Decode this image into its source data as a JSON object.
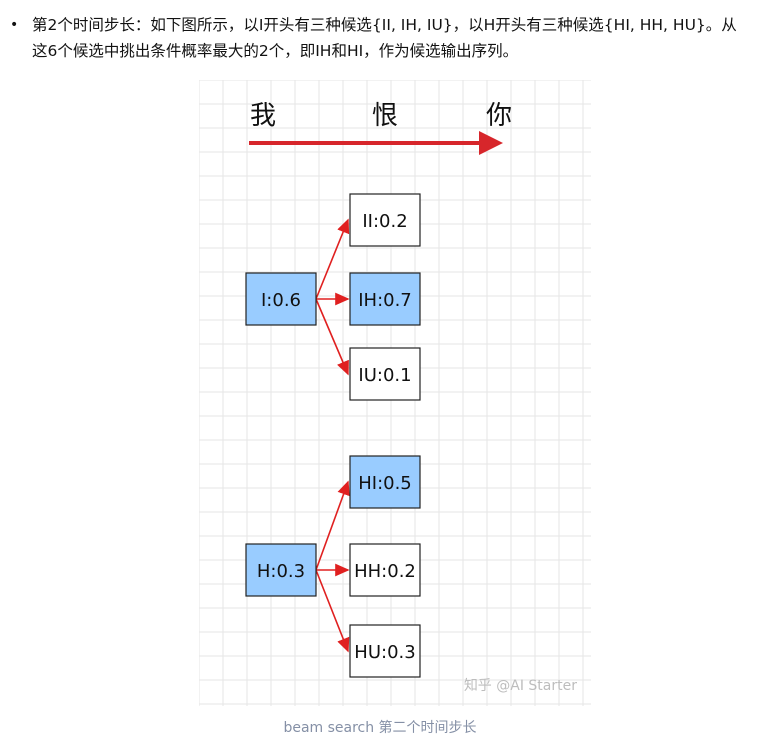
{
  "paragraph": {
    "bullet": "•",
    "text": "第2个时间步长：如下图所示，以I开头有三种候选{II, IH, IU}，以H开头有三种候选{HI, HH, HU}。从这6个候选中挑出条件概率最大的2个，即IH和HI，作为候选输出序列。"
  },
  "diagram": {
    "timeline": {
      "words": [
        "我",
        "恨",
        "你"
      ],
      "arrow_color": "#d7262b"
    },
    "groups": [
      {
        "parent": {
          "label": "I:0.6",
          "selected": true
        },
        "children": [
          {
            "label": "II:0.2",
            "selected": false
          },
          {
            "label": "IH:0.7",
            "selected": true
          },
          {
            "label": "IU:0.1",
            "selected": false
          }
        ]
      },
      {
        "parent": {
          "label": "H:0.3",
          "selected": true
        },
        "children": [
          {
            "label": "HI:0.5",
            "selected": true
          },
          {
            "label": "HH:0.2",
            "selected": false
          },
          {
            "label": "HU:0.3",
            "selected": false
          }
        ]
      }
    ],
    "colors": {
      "selected_fill": "#99ccff",
      "unselected_fill": "#ffffff",
      "edge": "#e02020",
      "grid": "#e6e6e6"
    },
    "watermark": "知乎 @AI Starter"
  },
  "caption": "beam search 第二个时间步长"
}
